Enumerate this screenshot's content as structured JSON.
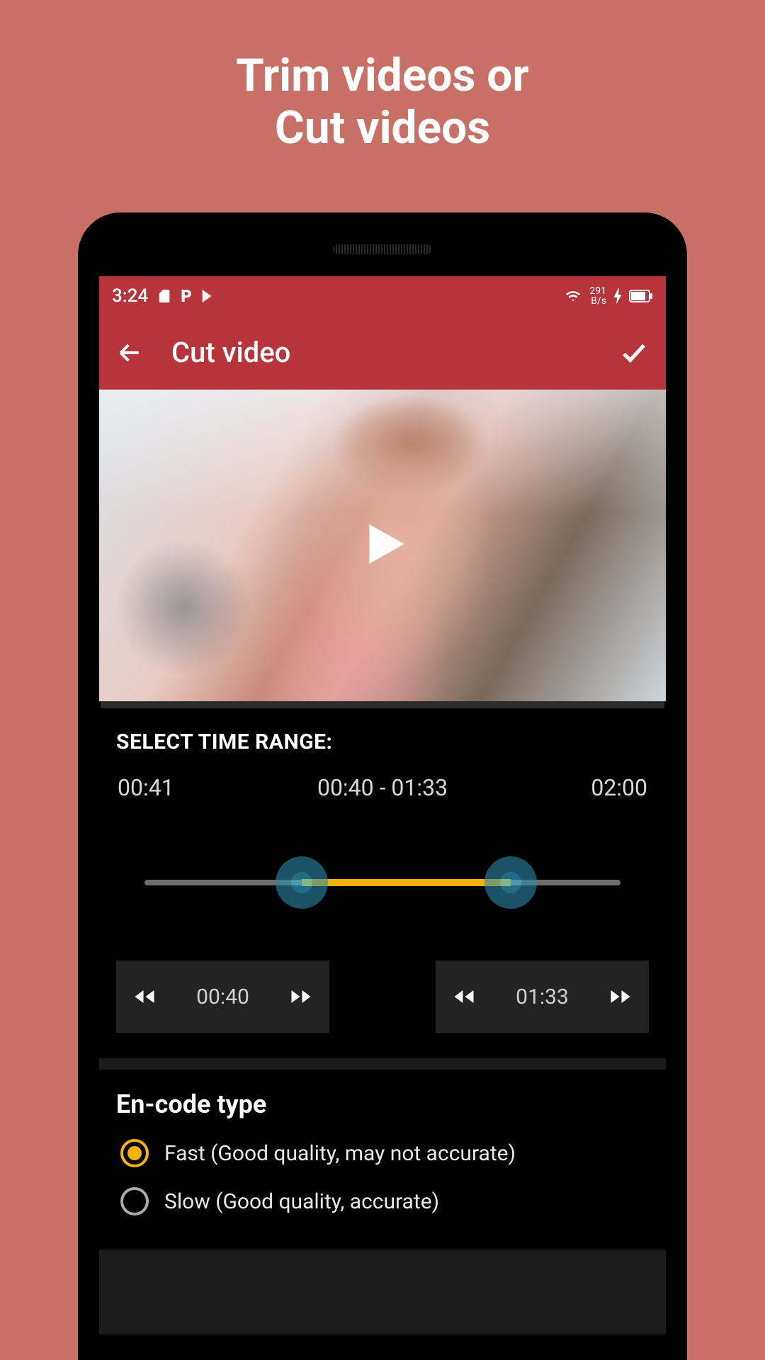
{
  "promo": {
    "line1": "Trim videos or",
    "line2": "Cut videos"
  },
  "status": {
    "time": "3:24",
    "net_value": "291",
    "net_unit": "B/s"
  },
  "appbar": {
    "title": "Cut video"
  },
  "range": {
    "label": "SELECT TIME RANGE:",
    "current": "00:41",
    "selection": "00:40 - 01:33",
    "total": "02:00",
    "start": "00:40",
    "end": "01:33",
    "start_pct": 33,
    "end_pct": 77
  },
  "encode": {
    "title": "En-code type",
    "options": [
      {
        "label": "Fast (Good quality, may not accurate)",
        "selected": true
      },
      {
        "label": "Slow (Good quality, accurate)",
        "selected": false
      }
    ]
  },
  "colors": {
    "accent": "#f5b400",
    "brand": "#b7343b",
    "handle": "#39b6df"
  }
}
